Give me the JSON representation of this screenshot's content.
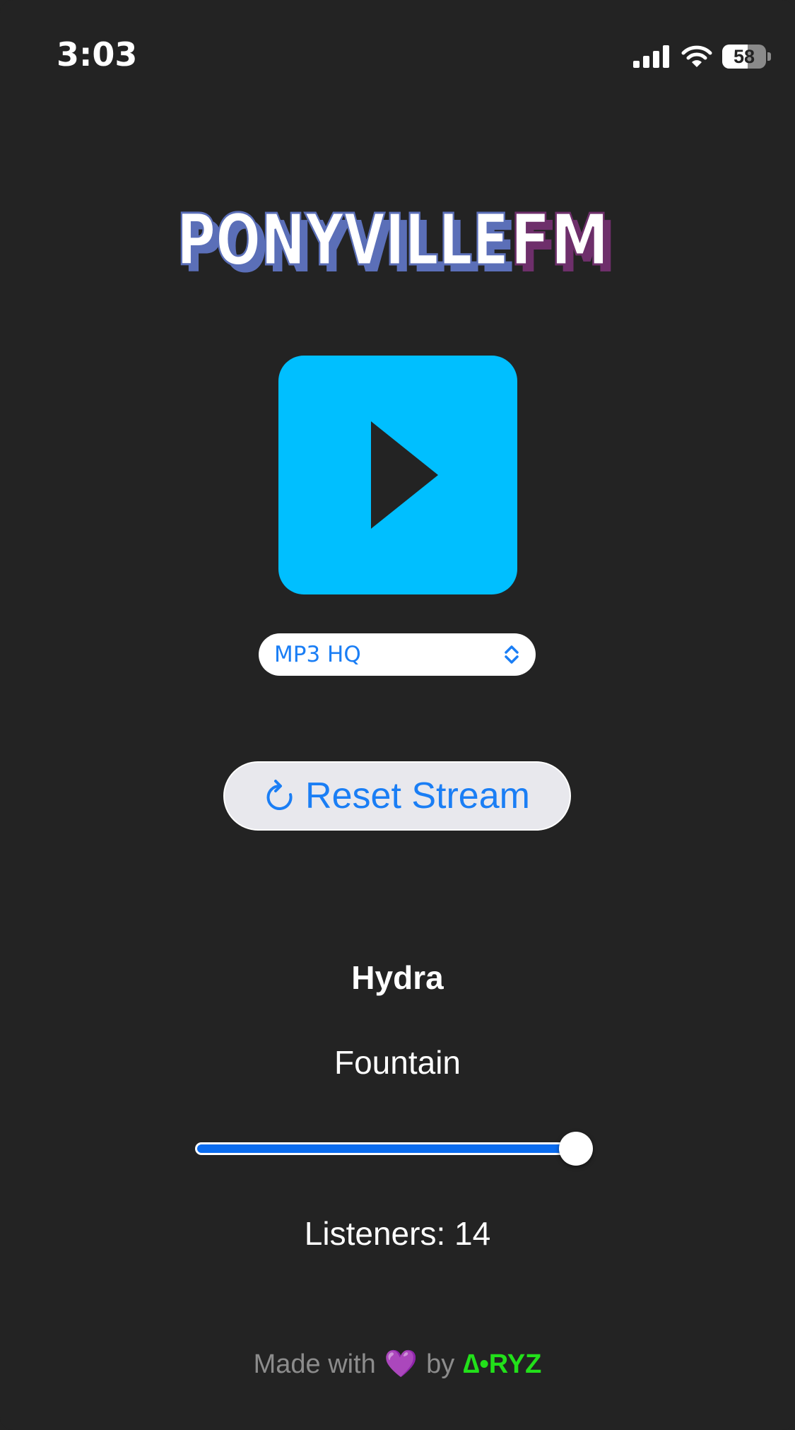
{
  "status_bar": {
    "time": "3:03",
    "battery_level": "58",
    "battery_fraction": 0.58,
    "icons": [
      "cellular-signal-icon",
      "wifi-icon",
      "battery-icon"
    ]
  },
  "logo": {
    "text_primary": "PONYVILLE",
    "text_secondary": "FM",
    "colors": {
      "face": "#ffffff",
      "primary_shadow": "#5b6fb8",
      "secondary_shadow": "#6e2f6b"
    }
  },
  "player": {
    "play_icon": "play-icon",
    "accent": "#00bfff"
  },
  "quality_select": {
    "selected": "MP3 HQ",
    "icon": "chevron-up-down-icon"
  },
  "reset_button": {
    "label": "Reset Stream",
    "icon": "refresh-icon"
  },
  "now_playing": {
    "artist": "Hydra",
    "title": "Fountain"
  },
  "volume": {
    "level": 0.98
  },
  "listeners": {
    "text": "Listeners: 14"
  },
  "footer": {
    "made_with": "Made with",
    "heart": "💜",
    "by": "by",
    "brand": "∆•RYZ"
  },
  "colors": {
    "background": "#232323",
    "link_blue": "#1a7ef5",
    "brand_green": "#22e01a"
  }
}
